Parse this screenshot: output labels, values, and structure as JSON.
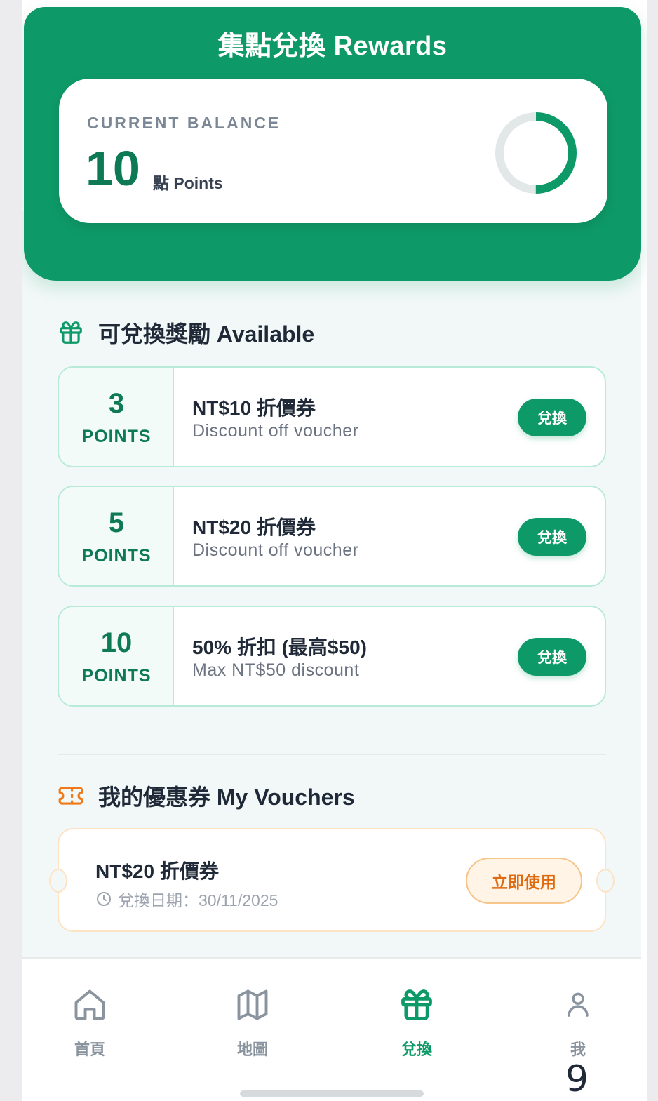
{
  "header": {
    "title": "集點兌換 Rewards"
  },
  "balance": {
    "label": "CURRENT BALANCE",
    "value": "10",
    "unit": "點 Points",
    "progress_fraction": 0.5
  },
  "available": {
    "title": "可兌換獎勵 Available",
    "icon": "gift-icon",
    "rewards": [
      {
        "points": "3",
        "points_label": "POINTS",
        "title": "NT$10 折價券",
        "subtitle": "Discount off voucher",
        "button": "兌換"
      },
      {
        "points": "5",
        "points_label": "POINTS",
        "title": "NT$20 折價券",
        "subtitle": "Discount off voucher",
        "button": "兌換"
      },
      {
        "points": "10",
        "points_label": "POINTS",
        "title": "50% 折扣 (最高$50)",
        "subtitle": "Max NT$50 discount",
        "button": "兌換"
      }
    ]
  },
  "my_vouchers": {
    "title": "我的優惠券 My Vouchers",
    "icon": "ticket-icon",
    "items": [
      {
        "title": "NT$20 折價券",
        "date": "兌換日期：30/11/2025",
        "button": "立即使用"
      }
    ]
  },
  "tabbar": {
    "tabs": [
      {
        "label": "首頁",
        "icon": "home-icon",
        "active": false
      },
      {
        "label": "地圖",
        "icon": "map-icon",
        "active": false
      },
      {
        "label": "兌換",
        "icon": "gift-icon",
        "active": true
      },
      {
        "label": "我",
        "icon": "user-icon",
        "active": false
      }
    ]
  },
  "page_number": "9",
  "colors": {
    "brand": "#0e9a68",
    "brand_dark": "#0e7a55",
    "accent_orange": "#e06a10",
    "card_border": "#b7ebd8",
    "voucher_border": "#fde3c4"
  }
}
